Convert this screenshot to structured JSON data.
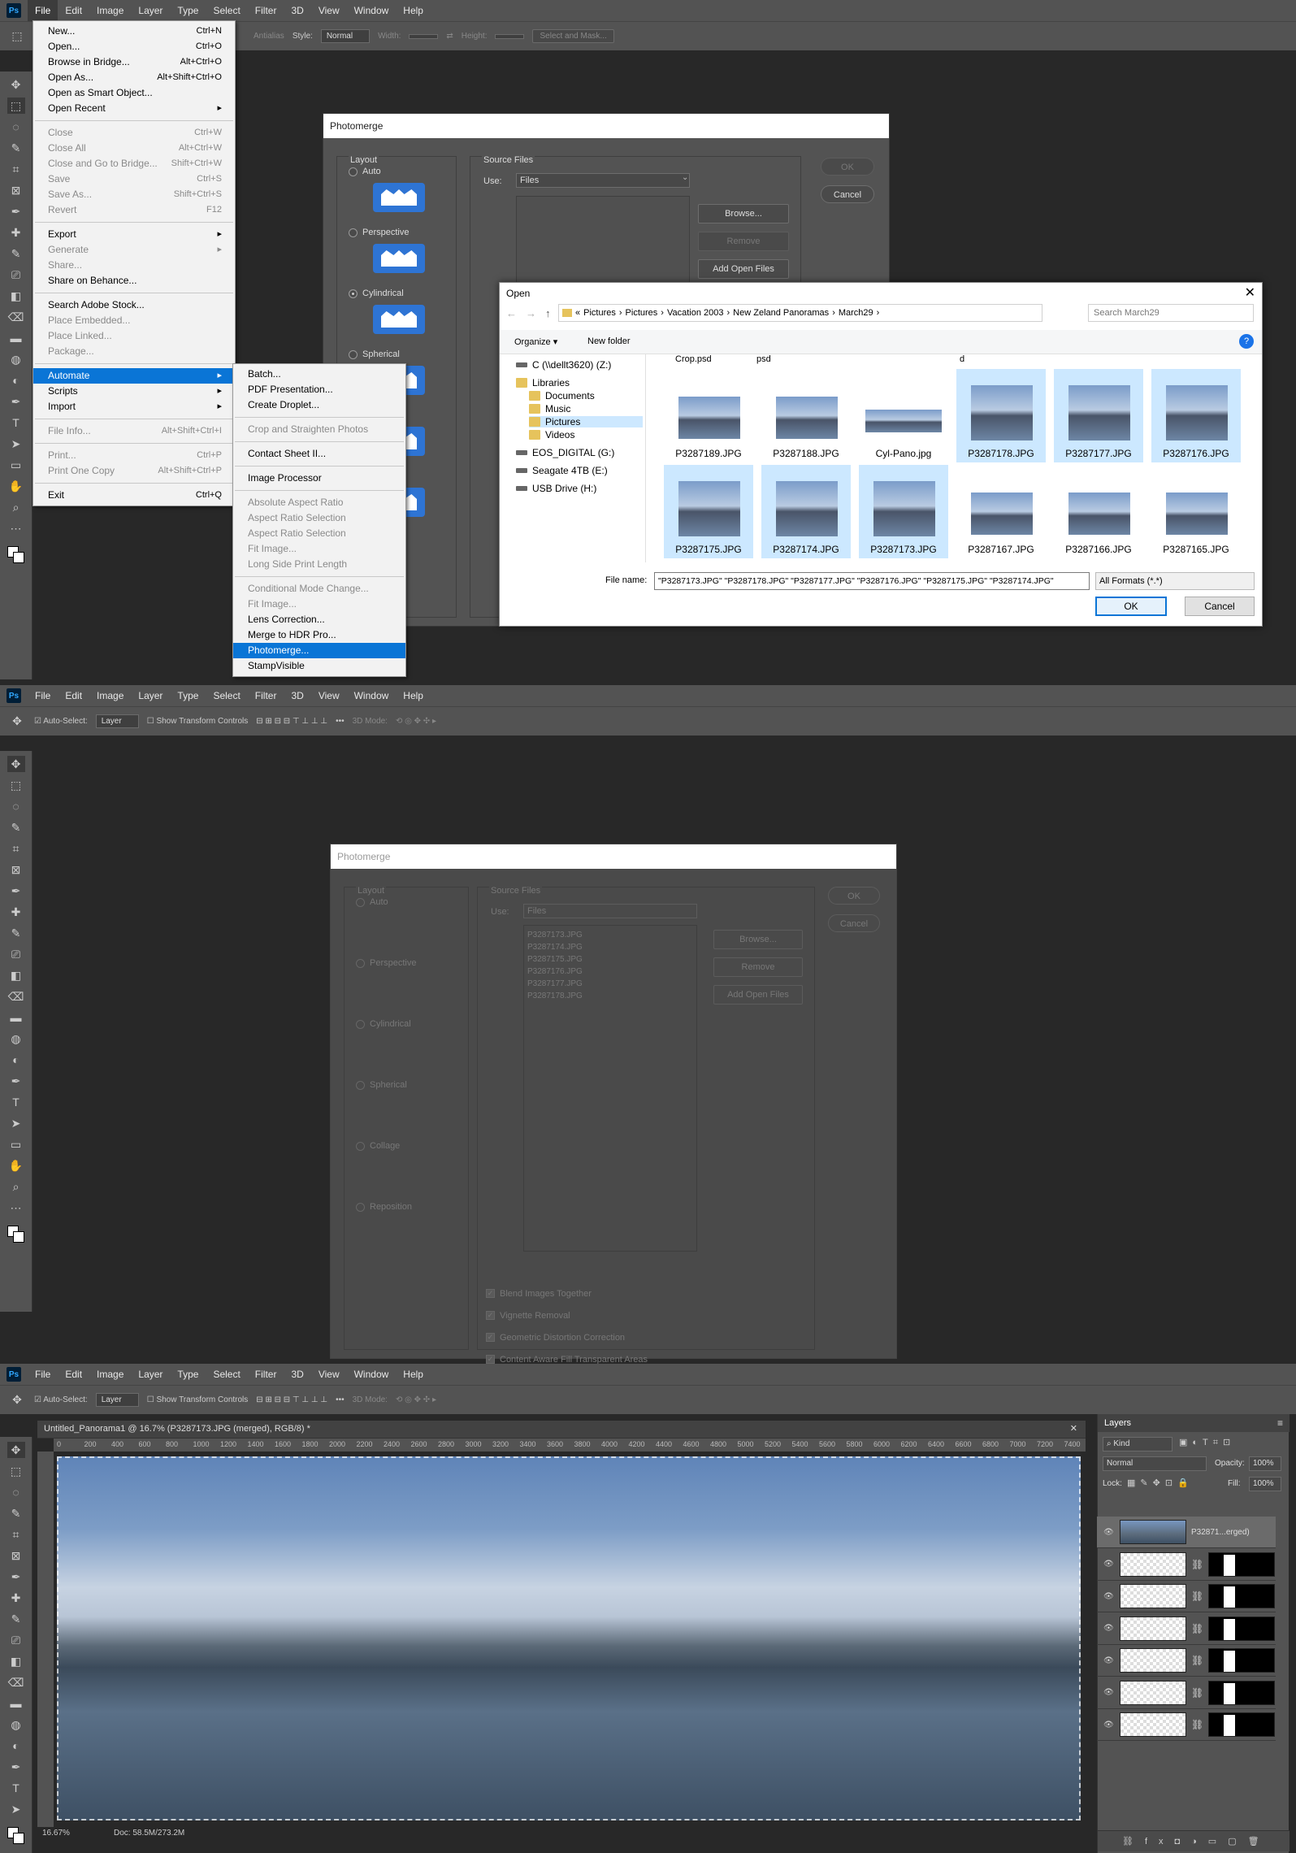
{
  "menubar": [
    "File",
    "Edit",
    "Image",
    "Layer",
    "Type",
    "Select",
    "Filter",
    "3D",
    "View",
    "Window",
    "Help"
  ],
  "ps_logo": "Ps",
  "options_top": {
    "antialias": "Antialias",
    "style_label": "Style:",
    "style_value": "Normal",
    "width_label": "Width:",
    "height_label": "Height:",
    "select_mask": "Select and Mask..."
  },
  "file_menu": [
    {
      "label": "New...",
      "shortcut": "Ctrl+N",
      "disabled": false
    },
    {
      "label": "Open...",
      "shortcut": "Ctrl+O",
      "disabled": false
    },
    {
      "label": "Browse in Bridge...",
      "shortcut": "Alt+Ctrl+O",
      "disabled": false
    },
    {
      "label": "Open As...",
      "shortcut": "Alt+Shift+Ctrl+O",
      "disabled": false
    },
    {
      "label": "Open as Smart Object...",
      "shortcut": "",
      "disabled": false
    },
    {
      "label": "Open Recent",
      "shortcut": "▸",
      "disabled": false
    },
    {
      "sep": true
    },
    {
      "label": "Close",
      "shortcut": "Ctrl+W",
      "disabled": true
    },
    {
      "label": "Close All",
      "shortcut": "Alt+Ctrl+W",
      "disabled": true
    },
    {
      "label": "Close and Go to Bridge...",
      "shortcut": "Shift+Ctrl+W",
      "disabled": true
    },
    {
      "label": "Save",
      "shortcut": "Ctrl+S",
      "disabled": true
    },
    {
      "label": "Save As...",
      "shortcut": "Shift+Ctrl+S",
      "disabled": true
    },
    {
      "label": "Revert",
      "shortcut": "F12",
      "disabled": true
    },
    {
      "sep": true
    },
    {
      "label": "Export",
      "shortcut": "▸",
      "disabled": false
    },
    {
      "label": "Generate",
      "shortcut": "▸",
      "disabled": true
    },
    {
      "label": "Share...",
      "shortcut": "",
      "disabled": true
    },
    {
      "label": "Share on Behance...",
      "shortcut": "",
      "disabled": false
    },
    {
      "sep": true
    },
    {
      "label": "Search Adobe Stock...",
      "shortcut": "",
      "disabled": false
    },
    {
      "label": "Place Embedded...",
      "shortcut": "",
      "disabled": true
    },
    {
      "label": "Place Linked...",
      "shortcut": "",
      "disabled": true
    },
    {
      "label": "Package...",
      "shortcut": "",
      "disabled": true
    },
    {
      "sep": true
    },
    {
      "label": "Automate",
      "shortcut": "▸",
      "disabled": false,
      "hi": true
    },
    {
      "label": "Scripts",
      "shortcut": "▸",
      "disabled": false
    },
    {
      "label": "Import",
      "shortcut": "▸",
      "disabled": false
    },
    {
      "sep": true
    },
    {
      "label": "File Info...",
      "shortcut": "Alt+Shift+Ctrl+I",
      "disabled": true
    },
    {
      "sep": true
    },
    {
      "label": "Print...",
      "shortcut": "Ctrl+P",
      "disabled": true
    },
    {
      "label": "Print One Copy",
      "shortcut": "Alt+Shift+Ctrl+P",
      "disabled": true
    },
    {
      "sep": true
    },
    {
      "label": "Exit",
      "shortcut": "Ctrl+Q",
      "disabled": false
    }
  ],
  "automate_menu": [
    {
      "label": "Batch...",
      "disabled": false
    },
    {
      "label": "PDF Presentation...",
      "disabled": false
    },
    {
      "label": "Create Droplet...",
      "disabled": false
    },
    {
      "sep": true
    },
    {
      "label": "Crop and Straighten Photos",
      "disabled": true
    },
    {
      "sep": true
    },
    {
      "label": "Contact Sheet II...",
      "disabled": false
    },
    {
      "sep": true
    },
    {
      "label": "Image Processor",
      "disabled": false
    },
    {
      "sep": true
    },
    {
      "label": "Absolute Aspect Ratio",
      "disabled": true
    },
    {
      "label": "Aspect Ratio Selection",
      "disabled": true
    },
    {
      "label": "Aspect Ratio Selection",
      "disabled": true
    },
    {
      "label": "Fit Image...",
      "disabled": true
    },
    {
      "label": "Long Side Print Length",
      "disabled": true
    },
    {
      "sep": true
    },
    {
      "label": "Conditional Mode Change...",
      "disabled": true
    },
    {
      "label": "Fit Image...",
      "disabled": true
    },
    {
      "label": "Lens Correction...",
      "disabled": false
    },
    {
      "label": "Merge to HDR Pro...",
      "disabled": false
    },
    {
      "label": "Photomerge...",
      "disabled": false,
      "hi": true
    },
    {
      "label": "StampVisible",
      "disabled": false
    }
  ],
  "photomerge": {
    "title": "Photomerge",
    "layout": "Layout",
    "source": "Source Files",
    "use": "Use:",
    "use_value": "Files",
    "options": [
      "Auto",
      "Perspective",
      "Cylindrical",
      "Spherical",
      "Collage",
      "Reposition"
    ],
    "selected": "Cylindrical",
    "ok": "OK",
    "cancel": "Cancel",
    "browse": "Browse...",
    "remove": "Remove",
    "add_open": "Add Open Files",
    "files": [
      "P3287173.JPG",
      "P3287174.JPG",
      "P3287175.JPG",
      "P3287176.JPG",
      "P3287177.JPG",
      "P3287178.JPG"
    ],
    "checks": [
      "Blend Images Together",
      "Vignette Removal",
      "Geometric Distortion Correction",
      "Content Aware Fill Transparent Areas"
    ]
  },
  "open_dialog": {
    "title": "Open",
    "path": [
      "«",
      "Pictures",
      "Pictures",
      "Vacation 2003",
      "New Zeland Panoramas",
      "March29"
    ],
    "search": "Search March29",
    "organize": "Organize ▾",
    "new_folder": "New folder",
    "nav": [
      {
        "label": "C (\\\\dellt3620) (Z:)",
        "type": "drv"
      },
      {
        "label": "Libraries",
        "type": "lib"
      },
      {
        "label": "Documents",
        "type": "lib"
      },
      {
        "label": "Music",
        "type": "lib"
      },
      {
        "label": "Pictures",
        "type": "lib",
        "sel": true
      },
      {
        "label": "Videos",
        "type": "lib"
      },
      {
        "label": "EOS_DIGITAL (G:)",
        "type": "drv"
      },
      {
        "label": "Seagate 4TB (E:)",
        "type": "drv"
      },
      {
        "label": "USB Drive (H:)",
        "type": "drv"
      }
    ],
    "top_labels": [
      "Crop.psd",
      "psd",
      "d"
    ],
    "thumbs_row1": [
      {
        "name": "P3287189.JPG",
        "sel": false,
        "kind": "wide"
      },
      {
        "name": "P3287188.JPG",
        "sel": false,
        "kind": "wide"
      },
      {
        "name": "Cyl-Pano.jpg",
        "sel": false,
        "kind": "pano"
      },
      {
        "name": "P3287178.JPG",
        "sel": true,
        "kind": "tall"
      },
      {
        "name": "P3287177.JPG",
        "sel": true,
        "kind": "tall"
      },
      {
        "name": "P3287176.JPG",
        "sel": true,
        "kind": "tall"
      }
    ],
    "thumbs_row2": [
      {
        "name": "P3287175.JPG",
        "sel": true,
        "kind": "tall"
      },
      {
        "name": "P3287174.JPG",
        "sel": true,
        "kind": "tall"
      },
      {
        "name": "P3287173.JPG",
        "sel": true,
        "kind": "tall"
      },
      {
        "name": "P3287167.JPG",
        "sel": false,
        "kind": "wide"
      },
      {
        "name": "P3287166.JPG",
        "sel": false,
        "kind": "wide"
      },
      {
        "name": "P3287165.JPG",
        "sel": false,
        "kind": "wide"
      }
    ],
    "file_name_label": "File name:",
    "file_name": "\"P3287173.JPG\" \"P3287178.JPG\" \"P3287177.JPG\" \"P3287176.JPG\" \"P3287175.JPG\" \"P3287174.JPG\"",
    "format": "All Formats (*.*)",
    "ok": "OK",
    "cancel": "Cancel"
  },
  "move_options": {
    "auto_select": "Auto-Select:",
    "layer": "Layer",
    "transform": "Show Transform Controls",
    "mode3d": "3D Mode:"
  },
  "document": {
    "tab": "Untitled_Panorama1 @ 16.7% (P3287173.JPG (merged), RGB/8) *",
    "zoom": "16.67%",
    "doc": "Doc: 58.5M/273.2M",
    "ruler_ticks": [
      "0",
      "200",
      "400",
      "600",
      "800",
      "1000",
      "1200",
      "1400",
      "1600",
      "1800",
      "2000",
      "2200",
      "2400",
      "2600",
      "2800",
      "3000",
      "3200",
      "3400",
      "3600",
      "3800",
      "4000",
      "4200",
      "4400",
      "4600",
      "4800",
      "5000",
      "5200",
      "5400",
      "5600",
      "5800",
      "6000",
      "6200",
      "6400",
      "6600",
      "6800",
      "7000",
      "7200",
      "7400"
    ]
  },
  "layers": {
    "title": "Layers",
    "kind": "Kind",
    "blend": "Normal",
    "opacity_label": "Opacity:",
    "opacity": "100%",
    "lock_label": "Lock:",
    "fill_label": "Fill:",
    "fill": "100%",
    "top_layer": "P32871...erged)"
  }
}
